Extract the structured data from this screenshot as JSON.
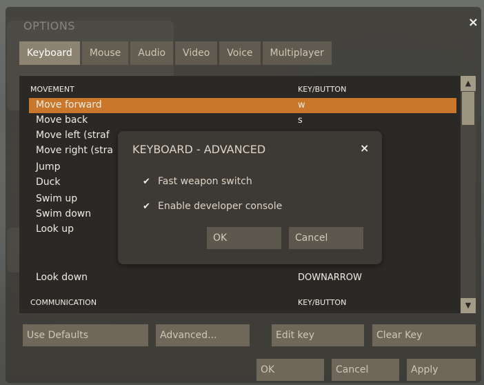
{
  "window": {
    "title": "OPTIONS",
    "close": "×"
  },
  "tabs": [
    {
      "label": "Keyboard",
      "active": true
    },
    {
      "label": "Mouse"
    },
    {
      "label": "Audio"
    },
    {
      "label": "Video"
    },
    {
      "label": "Voice"
    },
    {
      "label": "Multiplayer"
    }
  ],
  "list": {
    "section1": {
      "label": "MOVEMENT",
      "key_header": "KEY/BUTTON"
    },
    "rows": [
      {
        "action": "Move forward",
        "key": "w",
        "selected": true
      },
      {
        "action": "Move back",
        "key": "s"
      },
      {
        "action": "Move left (straf",
        "key": ""
      },
      {
        "action": "Move right (stra",
        "key": ""
      },
      {
        "action": "Jump",
        "key": ""
      },
      {
        "action": "Duck",
        "key": ""
      },
      {
        "action": "Swim up",
        "key": ""
      },
      {
        "action": "Swim down",
        "key": ""
      },
      {
        "action": "Look up",
        "key": ""
      },
      {
        "action": "Look down",
        "key": "DOWNARROW"
      }
    ],
    "section2": {
      "label": "COMMUNICATION",
      "key_header": "KEY/BUTTON"
    }
  },
  "buttons": {
    "use_defaults": "Use Defaults",
    "advanced": "Advanced...",
    "edit_key": "Edit key",
    "clear_key": "Clear Key",
    "ok": "OK",
    "cancel": "Cancel",
    "apply": "Apply"
  },
  "dialog": {
    "title": "KEYBOARD - ADVANCED",
    "close": "×",
    "options": [
      {
        "label": "Fast weapon switch",
        "checked": true
      },
      {
        "label": "Enable developer console",
        "checked": true
      }
    ],
    "ok": "OK",
    "cancel": "Cancel",
    "check_glyph": "✔"
  },
  "scroll": {
    "up": "▲",
    "down": "▼"
  }
}
